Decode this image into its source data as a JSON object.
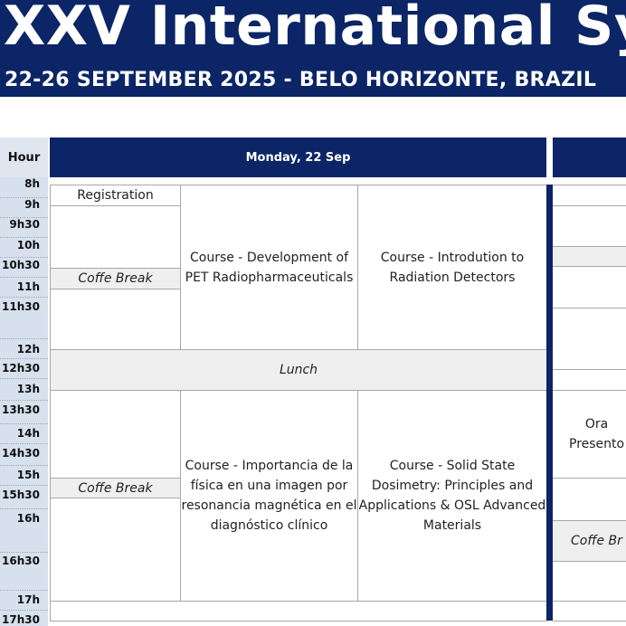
{
  "banner": {
    "title": "XXV International Sym",
    "subtitle": "22-26 SEPTEMBER 2025 - BELO HORIZONTE, BRAZIL"
  },
  "schedule": {
    "hour_header": "Hour",
    "days": [
      "Monday, 22 Sep"
    ],
    "hours": [
      "8h",
      "9h",
      "9h30",
      "10h",
      "10h30",
      "11h",
      "11h30",
      "12h",
      "12h30",
      "13h",
      "13h30",
      "14h",
      "14h30",
      "15h",
      "15h30",
      "16h",
      "16h30",
      "17h",
      "17h30"
    ],
    "events": {
      "registration": "Registration",
      "coffee_break_1": "Coffe Break",
      "course_pet": "Course - Development of PET Radiopharmaceuticals",
      "course_detectors": "Course - Introdution to Radiation Detectors",
      "lunch": "Lunch",
      "coffee_break_2": "Coffe Break",
      "course_mri": "Course - Importancia de la física en una imagen por resonancia magnética en el diagnóstico clínico",
      "course_dosimetry": "Course - Solid State Dosimetry: Principles and Applications & OSL Advanced Materials",
      "oral_presentations_partial": "Ora\nPresento",
      "coffee_break_3_partial": "Coffe Br"
    }
  }
}
